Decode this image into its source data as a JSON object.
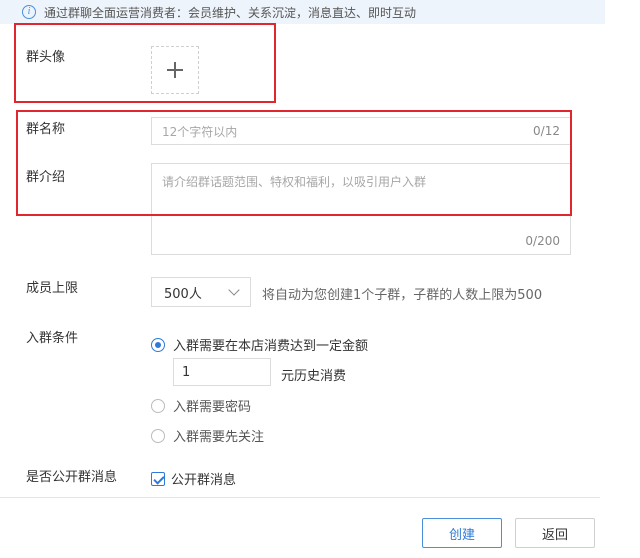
{
  "info_bar": {
    "icon": "info-icon",
    "text": "通过群聊全面运营消费者：会员维护、关系沉淀，消息直达、即时互动"
  },
  "form": {
    "avatar_label": "群头像",
    "name_label": "群名称",
    "name_placeholder": "12个字符以内",
    "name_counter": "0/12",
    "intro_label": "群介绍",
    "intro_placeholder": "请介绍群话题范围、特权和福利，以吸引用户入群",
    "intro_counter": "0/200",
    "limit_label": "成员上限",
    "limit_value": "500人",
    "limit_hint": "将自动为您创建1个子群，子群的人数上限为500",
    "condition_label": "入群条件",
    "condition_options": [
      {
        "label": "入群需要在本店消费达到一定金额",
        "selected": true
      },
      {
        "label": "入群需要密码",
        "selected": false
      },
      {
        "label": "入群需要先关注",
        "selected": false
      }
    ],
    "amount_value": "1",
    "amount_suffix": "元历史消费",
    "public_label": "是否公开群消息",
    "public_checkbox_label": "公开群消息",
    "public_checked": true
  },
  "buttons": {
    "create": "创建",
    "back": "返回"
  },
  "colors": {
    "accent": "#2f7ad8",
    "highlight": "#e0262e",
    "info_bg": "#eef4fb"
  }
}
